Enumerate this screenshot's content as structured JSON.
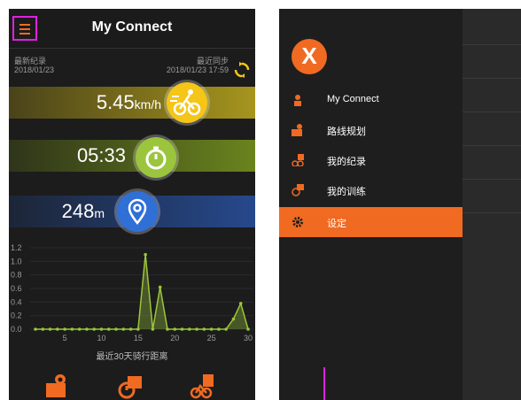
{
  "left": {
    "title": "My Connect",
    "last_record_label": "最新纪录",
    "last_record_date": "2018/01/23",
    "last_sync_label": "最近同步",
    "last_sync_date": "2018/01/23 17:59",
    "speed": {
      "value": "5.45",
      "unit": "km/h"
    },
    "duration": {
      "value": "05:33"
    },
    "distance": {
      "value": "248",
      "unit": "m"
    },
    "chart_caption": "最近30天骑行距离",
    "chart_data": {
      "type": "line",
      "x": [
        1,
        2,
        3,
        4,
        5,
        6,
        7,
        8,
        9,
        10,
        11,
        12,
        13,
        14,
        15,
        16,
        17,
        18,
        19,
        20,
        21,
        22,
        23,
        24,
        25,
        26,
        27,
        28,
        29,
        30
      ],
      "values": [
        0,
        0,
        0,
        0,
        0,
        0,
        0,
        0,
        0,
        0,
        0,
        0,
        0,
        0,
        0,
        1.1,
        0,
        0.62,
        0,
        0,
        0,
        0,
        0,
        0,
        0,
        0,
        0,
        0.15,
        0.38,
        0
      ],
      "xticks": [
        5,
        10,
        15,
        20,
        25,
        30
      ],
      "yticks": [
        0.0,
        0.2,
        0.4,
        0.6,
        0.8,
        1.0,
        1.2
      ],
      "ylim": [
        0,
        1.2
      ],
      "xlim": [
        1,
        30
      ],
      "color": "#9bc53d"
    }
  },
  "right": {
    "menu": [
      {
        "label": "My Connect",
        "icon": "person-icon"
      },
      {
        "label": "路线规划",
        "icon": "route-map-icon"
      },
      {
        "label": "我的纪录",
        "icon": "cyclist-records-icon"
      },
      {
        "label": "我的训练",
        "icon": "training-icon"
      },
      {
        "label": "设定",
        "icon": "gear-icon",
        "active": true
      }
    ],
    "logo_letter": "X"
  },
  "colors": {
    "accent": "#f06a22",
    "speed": "#f5c518",
    "timer": "#9bc53d",
    "distance": "#2f6fd6"
  }
}
